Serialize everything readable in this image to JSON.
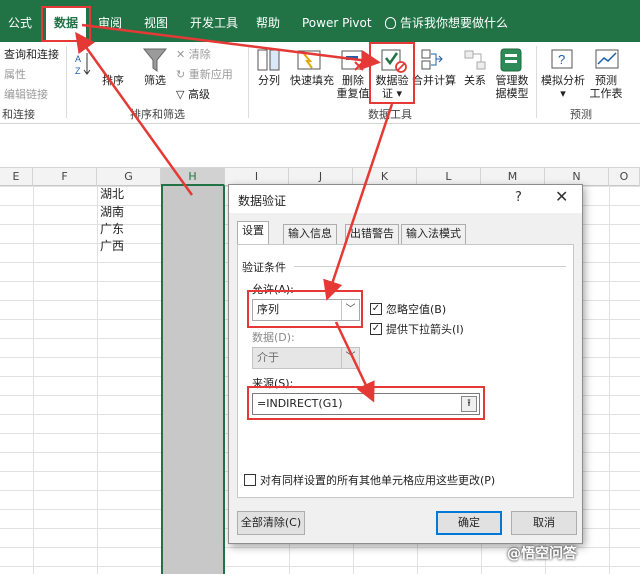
{
  "ribbon_tabs": {
    "formulas": "公式",
    "data": "数据",
    "review": "审阅",
    "view": "视图",
    "developer": "开发工具",
    "help": "帮助",
    "power_pivot": "Power Pivot",
    "tell_me": "告诉我你想要做什么"
  },
  "ribbon": {
    "queries_connections": "查询和连接",
    "properties": "属性",
    "edit_links": "编辑链接",
    "queries_group_label": "和连接",
    "sort": "排序",
    "filter": "筛选",
    "clear": "清除",
    "reapply": "重新应用",
    "advanced": "高级",
    "sort_filter_group": "排序和筛选",
    "text_to_columns": "分列",
    "flash_fill": "快速填充",
    "remove_duplicates_1": "删除",
    "remove_duplicates_2": "重复值",
    "data_validation_1": "数据验",
    "data_validation_2": "证",
    "consolidate": "合并计算",
    "relationships": "关系",
    "manage_model_1": "管理数",
    "manage_model_2": "据模型",
    "data_tools_group": "数据工具",
    "what_if_1": "模拟分析",
    "forecast_sheet_1": "预测",
    "forecast_sheet_2": "工作表",
    "forecast_group": "预测"
  },
  "columns": [
    "E",
    "F",
    "G",
    "H",
    "I",
    "J",
    "K",
    "L",
    "M",
    "N",
    "O"
  ],
  "cells": [
    "湖北",
    "湖南",
    "广东",
    "广西"
  ],
  "dialog": {
    "title": "数据验证",
    "help": "?",
    "tabs": [
      "设置",
      "输入信息",
      "出错警告",
      "输入法模式"
    ],
    "criteria_label": "验证条件",
    "allow_label": "允许(A):",
    "allow_value": "序列",
    "ignore_blank": "忽略空值(B)",
    "in_cell_dropdown": "提供下拉箭头(I)",
    "data_label": "数据(D):",
    "data_value": "介于",
    "source_label": "来源(S):",
    "source_value": "=INDIRECT(G1)",
    "apply_all": "对有同样设置的所有其他单元格应用这些更改(P)",
    "clear_all": "全部清除(C)",
    "ok": "确定",
    "cancel": "取消"
  },
  "watermark": "@悟空问答",
  "colors": {
    "ribbon_green": "#217346",
    "annotation_red": "#e53935",
    "selection_grey": "#c8c8c8"
  }
}
